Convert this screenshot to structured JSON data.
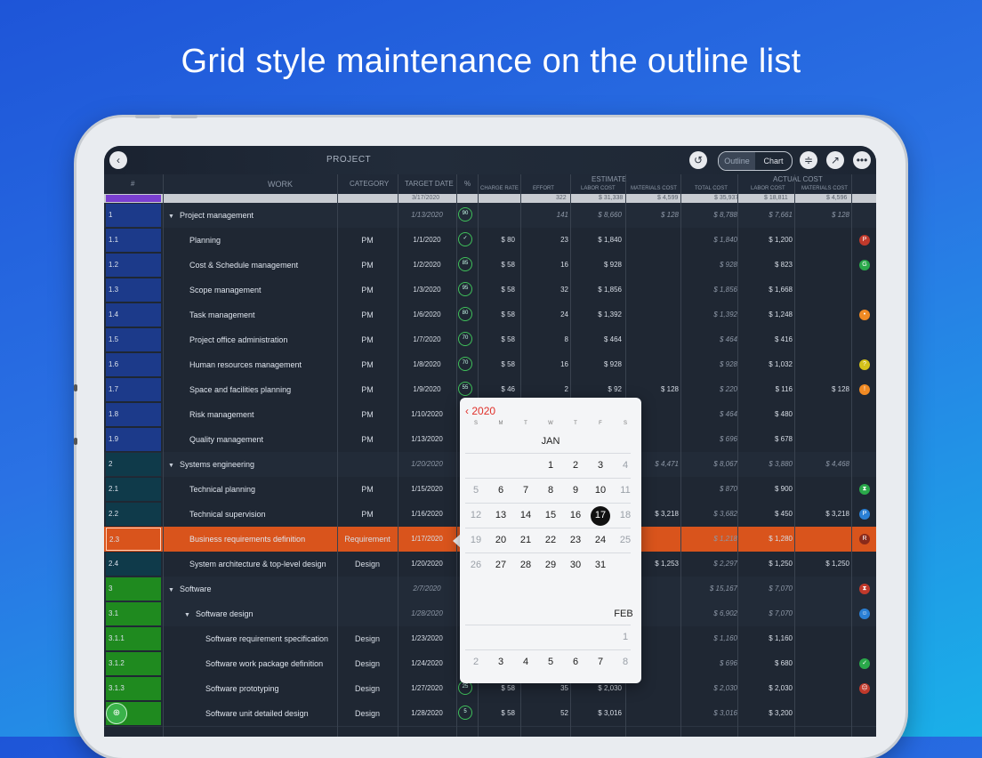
{
  "headline": "Grid style maintenance on the outline list",
  "toolbar": {
    "back_icon": "chevron-left-icon",
    "title": "PROJECT",
    "undo_icon": "undo-icon",
    "outline_label": "Outline",
    "chart_label": "Chart",
    "filter_icon": "filter-icon",
    "share_icon": "share-icon",
    "more_icon": "more-icon"
  },
  "columns": {
    "num": "#",
    "work": "WORK",
    "category": "CATEGORY",
    "target_date": "TARGET DATE",
    "pct": "%",
    "estimate": "ESTIMATE",
    "actual_cost": "ACTUAL COST",
    "charge_rate": "CHARGE RATE",
    "effort": "EFFORT",
    "labor_cost": "LABOR COST",
    "materials_cost": "MATERIALS COST",
    "total_cost": "TOTAL COST",
    "act_labor_cost": "LABOR COST",
    "act_materials_cost": "MATERIALS COST"
  },
  "summary": {
    "date": "3/17/2020",
    "effort": "322",
    "labor": "$ 31,338",
    "materials": "$ 4,599",
    "total": "$ 35,937",
    "act_labor": "$ 18,811",
    "act_materials": "$ 4,596"
  },
  "rows": [
    {
      "num": "1",
      "work": "Project management",
      "group": true,
      "indent": 0,
      "cat": "",
      "date": "1/13/2020",
      "pct": "90",
      "rate": "",
      "effort": "141",
      "labor": "$ 8,660",
      "mat": "$ 128",
      "total": "$ 8,788",
      "alabor": "$ 7,661",
      "amat": "$ 128",
      "flag": "",
      "flagColor": "",
      "numColor": "#1c3a8a"
    },
    {
      "num": "1.1",
      "work": "Planning",
      "indent": 1,
      "cat": "PM",
      "date": "1/1/2020",
      "pct": "✓",
      "rate": "$ 80",
      "effort": "23",
      "labor": "$ 1,840",
      "mat": "",
      "total": "$ 1,840",
      "alabor": "$ 1,200",
      "amat": "",
      "flag": "P",
      "flagColor": "#c0392b",
      "numColor": "#1c3a8a"
    },
    {
      "num": "1.2",
      "work": "Cost & Schedule management",
      "indent": 1,
      "cat": "PM",
      "date": "1/2/2020",
      "pct": "85",
      "rate": "$ 58",
      "effort": "16",
      "labor": "$ 928",
      "mat": "",
      "total": "$ 928",
      "alabor": "$ 823",
      "amat": "",
      "flag": "G",
      "flagColor": "#2aa84a",
      "numColor": "#1c3a8a"
    },
    {
      "num": "1.3",
      "work": "Scope management",
      "indent": 1,
      "cat": "PM",
      "date": "1/3/2020",
      "pct": "95",
      "rate": "$ 58",
      "effort": "32",
      "labor": "$ 1,856",
      "mat": "",
      "total": "$ 1,856",
      "alabor": "$ 1,668",
      "amat": "",
      "flag": "",
      "flagColor": "",
      "numColor": "#1c3a8a"
    },
    {
      "num": "1.4",
      "work": "Task management",
      "indent": 1,
      "cat": "PM",
      "date": "1/6/2020",
      "pct": "80",
      "rate": "$ 58",
      "effort": "24",
      "labor": "$ 1,392",
      "mat": "",
      "total": "$ 1,392",
      "alabor": "$ 1,248",
      "amat": "",
      "flag": "•",
      "flagColor": "#f08a24",
      "numColor": "#1c3a8a"
    },
    {
      "num": "1.5",
      "work": "Project office administration",
      "indent": 1,
      "cat": "PM",
      "date": "1/7/2020",
      "pct": "70",
      "rate": "$ 58",
      "effort": "8",
      "labor": "$ 464",
      "mat": "",
      "total": "$ 464",
      "alabor": "$ 416",
      "amat": "",
      "flag": "",
      "flagColor": "",
      "numColor": "#1c3a8a"
    },
    {
      "num": "1.6",
      "work": "Human resources management",
      "indent": 1,
      "cat": "PM",
      "date": "1/8/2020",
      "pct": "70",
      "rate": "$ 58",
      "effort": "16",
      "labor": "$ 928",
      "mat": "",
      "total": "$ 928",
      "alabor": "$ 1,032",
      "amat": "",
      "flag": "?",
      "flagColor": "#d4c21a",
      "numColor": "#1c3a8a"
    },
    {
      "num": "1.7",
      "work": "Space and facilities planning",
      "indent": 1,
      "cat": "PM",
      "date": "1/9/2020",
      "pct": "55",
      "rate": "$ 46",
      "effort": "2",
      "labor": "$ 92",
      "mat": "$ 128",
      "total": "$ 220",
      "alabor": "$ 116",
      "amat": "$ 128",
      "flag": "!",
      "flagColor": "#f08a24",
      "numColor": "#1c3a8a"
    },
    {
      "num": "1.8",
      "work": "Risk management",
      "indent": 1,
      "cat": "PM",
      "date": "1/10/2020",
      "pct": "",
      "rate": "",
      "effort": "",
      "labor": "",
      "mat": "",
      "total": "$ 464",
      "alabor": "$ 480",
      "amat": "",
      "flag": "",
      "flagColor": "",
      "numColor": "#1c3a8a"
    },
    {
      "num": "1.9",
      "work": "Quality management",
      "indent": 1,
      "cat": "PM",
      "date": "1/13/2020",
      "pct": "",
      "rate": "",
      "effort": "",
      "labor": "",
      "mat": "",
      "total": "$ 696",
      "alabor": "$ 678",
      "amat": "",
      "flag": "",
      "flagColor": "",
      "numColor": "#1c3a8a"
    },
    {
      "num": "2",
      "work": "Systems engineering",
      "group": true,
      "indent": 0,
      "cat": "",
      "date": "1/20/2020",
      "pct": "",
      "rate": "",
      "effort": "",
      "labor": "",
      "mat": "$ 4,471",
      "total": "$ 8,067",
      "alabor": "$ 3,880",
      "amat": "$ 4,468",
      "flag": "",
      "flagColor": "",
      "numColor": "#0f3a4a"
    },
    {
      "num": "2.1",
      "work": "Technical planning",
      "indent": 1,
      "cat": "PM",
      "date": "1/15/2020",
      "pct": "",
      "rate": "",
      "effort": "",
      "labor": "",
      "mat": "",
      "total": "$ 870",
      "alabor": "$ 900",
      "amat": "",
      "flag": "⧗",
      "flagColor": "#2aa84a",
      "numColor": "#0f3a4a"
    },
    {
      "num": "2.2",
      "work": "Technical supervision",
      "indent": 1,
      "cat": "PM",
      "date": "1/16/2020",
      "pct": "",
      "rate": "",
      "effort": "",
      "labor": "",
      "mat": "$ 3,218",
      "total": "$ 3,682",
      "alabor": "$ 450",
      "amat": "$ 3,218",
      "flag": "P",
      "flagColor": "#2a7fd4",
      "numColor": "#0f3a4a"
    },
    {
      "num": "2.3",
      "work": "Business requirements definition",
      "indent": 1,
      "cat": "Requirement",
      "date": "1/17/2020",
      "pct": "",
      "rate": "",
      "effort": "",
      "labor": "",
      "mat": "",
      "total": "$ 1,218",
      "alabor": "$ 1,280",
      "amat": "",
      "flag": "R",
      "flagColor": "#8a2a1a",
      "numColor": "#d9541c",
      "selected": true
    },
    {
      "num": "2.4",
      "work": "System architecture & top-level design",
      "indent": 1,
      "cat": "Design",
      "date": "1/20/2020",
      "pct": "",
      "rate": "",
      "effort": "",
      "labor": "",
      "mat": "$ 1,253",
      "total": "$ 2,297",
      "alabor": "$ 1,250",
      "amat": "$ 1,250",
      "flag": "",
      "flagColor": "",
      "numColor": "#0f3a4a"
    },
    {
      "num": "3",
      "work": "Software",
      "group": true,
      "indent": 0,
      "cat": "",
      "date": "2/7/2020",
      "pct": "",
      "rate": "",
      "effort": "",
      "labor": "",
      "mat": "",
      "total": "$ 15,167",
      "alabor": "$ 7,070",
      "amat": "",
      "flag": "⧗",
      "flagColor": "#c0392b",
      "numColor": "#1f8a1f"
    },
    {
      "num": "3.1",
      "work": "Software design",
      "group": true,
      "indent": 1,
      "cat": "",
      "date": "1/28/2020",
      "pct": "",
      "rate": "",
      "effort": "",
      "labor": "",
      "mat": "",
      "total": "$ 6,902",
      "alabor": "$ 7,070",
      "amat": "",
      "flag": "☺",
      "flagColor": "#2a7fd4",
      "numColor": "#1f8a1f"
    },
    {
      "num": "3.1.1",
      "work": "Software requirement specification",
      "indent": 2,
      "cat": "Design",
      "date": "1/23/2020",
      "pct": "",
      "rate": "",
      "effort": "",
      "labor": "",
      "mat": "",
      "total": "$ 1,160",
      "alabor": "$ 1,160",
      "amat": "",
      "flag": "",
      "flagColor": "",
      "numColor": "#1f8a1f"
    },
    {
      "num": "3.1.2",
      "work": "Software work package definition",
      "indent": 2,
      "cat": "Design",
      "date": "1/24/2020",
      "pct": "",
      "rate": "",
      "effort": "",
      "labor": "",
      "mat": "",
      "total": "$ 696",
      "alabor": "$ 680",
      "amat": "",
      "flag": "✓",
      "flagColor": "#2aa84a",
      "numColor": "#1f8a1f"
    },
    {
      "num": "3.1.3",
      "work": "Software prototyping",
      "indent": 2,
      "cat": "Design",
      "date": "1/27/2020",
      "pct": "25",
      "rate": "$ 58",
      "effort": "35",
      "labor": "$ 2,030",
      "mat": "",
      "total": "$ 2,030",
      "alabor": "$ 2,030",
      "amat": "",
      "flag": "☹",
      "flagColor": "#c0392b",
      "numColor": "#1f8a1f"
    },
    {
      "num": "",
      "work": "Software unit detailed design",
      "indent": 2,
      "cat": "Design",
      "date": "1/28/2020",
      "pct": "5",
      "rate": "$ 58",
      "effort": "52",
      "labor": "$ 3,016",
      "mat": "",
      "total": "$ 3,016",
      "alabor": "$ 3,200",
      "amat": "",
      "flag": "",
      "flagColor": "",
      "numColor": "#1f8a1f"
    }
  ],
  "calendar": {
    "year": "2020",
    "weekdays": [
      "S",
      "M",
      "T",
      "W",
      "T",
      "F",
      "S"
    ],
    "month1": "JAN",
    "month2": "FEB",
    "jan_weeks": [
      [
        "",
        "",
        "",
        "1",
        "2",
        "3",
        "4"
      ],
      [
        "5",
        "6",
        "7",
        "8",
        "9",
        "10",
        "11"
      ],
      [
        "12",
        "13",
        "14",
        "15",
        "16",
        "17",
        "18"
      ],
      [
        "19",
        "20",
        "21",
        "22",
        "23",
        "24",
        "25"
      ],
      [
        "26",
        "27",
        "28",
        "29",
        "30",
        "31",
        ""
      ]
    ],
    "feb_weeks": [
      [
        "",
        "",
        "",
        "",
        "",
        "",
        "1"
      ],
      [
        "2",
        "3",
        "4",
        "5",
        "6",
        "7",
        "8"
      ]
    ],
    "selected_day": "17"
  },
  "fab_icon": "add-icon"
}
